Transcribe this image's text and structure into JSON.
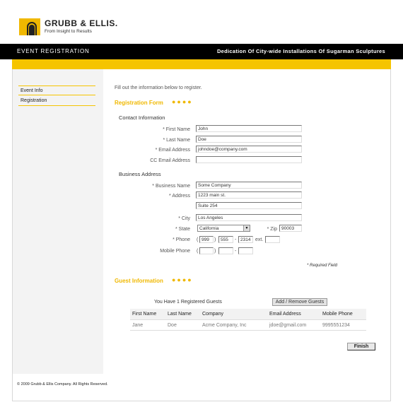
{
  "brand": {
    "name": "GRUBB & ELLIS.",
    "tagline": "From Insight to Results",
    "accent": "#f0b800"
  },
  "topbar": {
    "left": "EVENT REGISTRATION",
    "right": "Dedication Of City-wide Installations Of Sugarman Sculptures"
  },
  "sidebar": {
    "items": [
      {
        "label": "Event Info"
      },
      {
        "label": "Registration"
      }
    ]
  },
  "intro": "Fill out the information below to register.",
  "registration": {
    "title": "Registration Form",
    "dots": "●●●●",
    "contact_title": "Contact Information",
    "first_name": {
      "label": "* First Name",
      "value": "John"
    },
    "last_name": {
      "label": "* Last Name",
      "value": "Doe"
    },
    "email": {
      "label": "* Email Address",
      "value": "johndoe@company.com"
    },
    "cc_email": {
      "label": "CC Email Address",
      "value": ""
    },
    "business_title": "Business Address",
    "business_name": {
      "label": "* Business Name",
      "value": "Some Company"
    },
    "address": {
      "label": "* Address",
      "value1": "1223 main st.",
      "value2": "Suite 254"
    },
    "city": {
      "label": "* City",
      "value": "Los Angeles"
    },
    "state": {
      "label": "* State",
      "value": "California"
    },
    "zip": {
      "label": "* Zip",
      "value": "90003"
    },
    "phone": {
      "label": "* Phone",
      "area": "999",
      "prefix": "555",
      "line": "2314",
      "ext_label": "ext.",
      "ext": ""
    },
    "mobile": {
      "label": "Mobile Phone",
      "area": "",
      "prefix": "",
      "line": ""
    },
    "sep_open": "(",
    "sep_close": ")",
    "sep_dash": "-",
    "required_note": "* Required Field"
  },
  "guests": {
    "title": "Guest Information",
    "dots": "●●●●",
    "count_text": "You Have 1 Registered Guests",
    "button": "Add / Remove Guests",
    "columns": [
      "First Name",
      "Last Name",
      "Company",
      "Email Address",
      "Mobile Phone"
    ],
    "rows": [
      [
        "Jane",
        "Doe",
        "Acme Company, Inc",
        "jdoe@gmail.com",
        "9995551234"
      ]
    ]
  },
  "finish_button": "Finish",
  "footer": "© 2009 Grubb & Ellis Company. All Rights Reserved."
}
